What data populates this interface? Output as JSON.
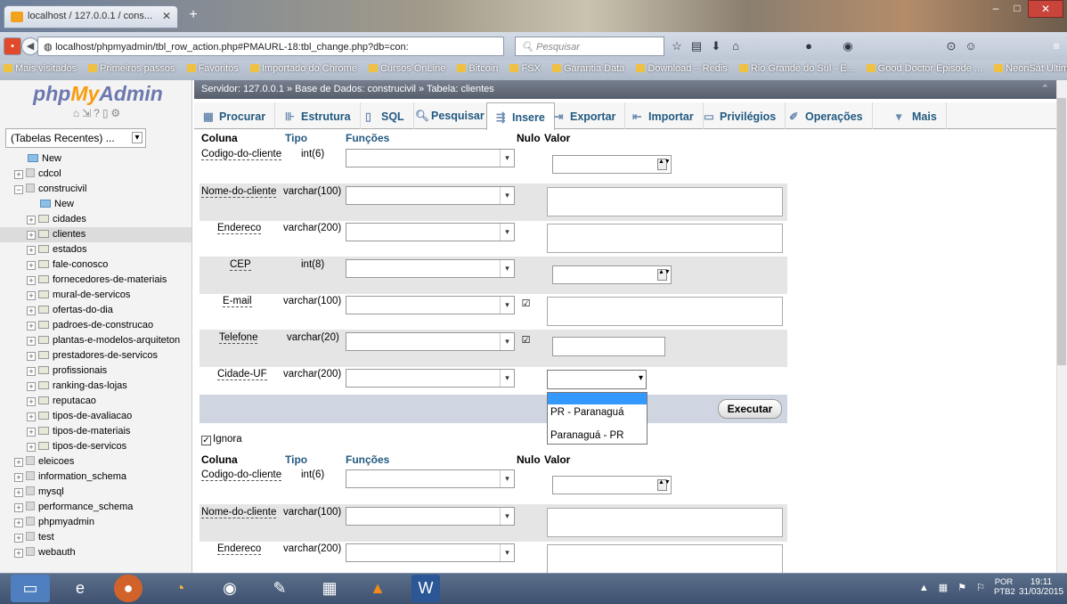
{
  "browser": {
    "tab_title": "localhost / 127.0.0.1 / cons...",
    "url": "localhost/phpmyadmin/tbl_row_action.php#PMAURL-18:tbl_change.php?db=con:",
    "search_placeholder": "Pesquisar",
    "bookmarks": [
      "Mais visitados",
      "Primeiros passos",
      "Favoritos",
      "Importado do Chrome",
      "Cursos OnLine",
      "Bitcoin",
      "FSX",
      "Garantia Data",
      "Download – Redis",
      "Rio Grande do Sul - E...",
      "Good Doctor Episode ...",
      "NeonSat Ultimate | Te..."
    ]
  },
  "sidebar": {
    "logo_php": "php",
    "logo_my": "MyAdmin",
    "logo_admin": "Admin",
    "recent_label": "(Tabelas Recentes) ...",
    "items": [
      {
        "label": "New",
        "kind": "new",
        "level": 0
      },
      {
        "label": "cdcol",
        "kind": "db",
        "level": 0
      },
      {
        "label": "construcivil",
        "kind": "db",
        "level": 0
      },
      {
        "label": "New",
        "kind": "new",
        "level": 1
      },
      {
        "label": "cidades",
        "kind": "table",
        "level": 1
      },
      {
        "label": "clientes",
        "kind": "table",
        "level": 1,
        "selected": true
      },
      {
        "label": "estados",
        "kind": "table",
        "level": 1
      },
      {
        "label": "fale-conosco",
        "kind": "table",
        "level": 1
      },
      {
        "label": "fornecedores-de-materiais",
        "kind": "table",
        "level": 1
      },
      {
        "label": "mural-de-servicos",
        "kind": "table",
        "level": 1
      },
      {
        "label": "ofertas-do-dia",
        "kind": "table",
        "level": 1
      },
      {
        "label": "padroes-de-construcao",
        "kind": "table",
        "level": 1
      },
      {
        "label": "plantas-e-modelos-arquiteton",
        "kind": "table",
        "level": 1
      },
      {
        "label": "prestadores-de-servicos",
        "kind": "table",
        "level": 1
      },
      {
        "label": "profissionais",
        "kind": "table",
        "level": 1
      },
      {
        "label": "ranking-das-lojas",
        "kind": "table",
        "level": 1
      },
      {
        "label": "reputacao",
        "kind": "table",
        "level": 1
      },
      {
        "label": "tipos-de-avaliacao",
        "kind": "table",
        "level": 1
      },
      {
        "label": "tipos-de-materiais",
        "kind": "table",
        "level": 1
      },
      {
        "label": "tipos-de-servicos",
        "kind": "table",
        "level": 1
      },
      {
        "label": "eleicoes",
        "kind": "db",
        "level": 0
      },
      {
        "label": "information_schema",
        "kind": "db",
        "level": 0
      },
      {
        "label": "mysql",
        "kind": "db",
        "level": 0
      },
      {
        "label": "performance_schema",
        "kind": "db",
        "level": 0
      },
      {
        "label": "phpmyadmin",
        "kind": "db",
        "level": 0
      },
      {
        "label": "test",
        "kind": "db",
        "level": 0
      },
      {
        "label": "webauth",
        "kind": "db",
        "level": 0
      }
    ]
  },
  "breadcrumb": "Servidor: 127.0.0.1 » Base de Dados: construcivil » Tabela: clientes",
  "tabs": [
    {
      "label": "Procurar",
      "icon": "table-icon"
    },
    {
      "label": "Estrutura",
      "icon": "structure-icon"
    },
    {
      "label": "SQL",
      "icon": "sql-icon"
    },
    {
      "label": "Pesquisar",
      "icon": "search-icon"
    },
    {
      "label": "Insere",
      "icon": "insert-icon",
      "active": true
    },
    {
      "label": "Exportar",
      "icon": "export-icon"
    },
    {
      "label": "Importar",
      "icon": "import-icon"
    },
    {
      "label": "Privilégios",
      "icon": "privileges-icon"
    },
    {
      "label": "Operações",
      "icon": "wrench-icon"
    },
    {
      "label": "Mais",
      "icon": "chevron-down-icon"
    }
  ],
  "form": {
    "headers": {
      "coluna": "Coluna",
      "tipo": "Tipo",
      "funcoes": "Funções",
      "nulo": "Nulo",
      "valor": "Valor"
    },
    "rows1": [
      {
        "column": "Codigo-do-cliente",
        "type": "int(6)",
        "input": "number",
        "nulo": false
      },
      {
        "column": "Nome-do-cliente",
        "type": "varchar(100)",
        "input": "textarea",
        "nulo": false
      },
      {
        "column": "Endereco",
        "type": "varchar(200)",
        "input": "textarea",
        "nulo": false
      },
      {
        "column": "CEP",
        "type": "int(8)",
        "input": "number",
        "nulo": false
      },
      {
        "column": "E-mail",
        "type": "varchar(100)",
        "input": "textarea",
        "nulo": true
      },
      {
        "column": "Telefone",
        "type": "varchar(20)",
        "input": "text",
        "nulo": true
      },
      {
        "column": "Cidade-UF",
        "type": "varchar(200)",
        "input": "select",
        "nulo": false
      }
    ],
    "rows2": [
      {
        "column": "Codigo-do-cliente",
        "type": "int(6)",
        "input": "number"
      },
      {
        "column": "Nome-do-cliente",
        "type": "varchar(100)",
        "input": "textarea"
      },
      {
        "column": "Endereco",
        "type": "varchar(200)",
        "input": "textarea"
      }
    ],
    "execute_label": "Executar",
    "ignore_label": "Ignora",
    "dropdown_options": [
      "",
      "PR - Paranaguá",
      "Paranaguá - PR"
    ]
  },
  "taskbar": {
    "lang": "POR",
    "lang2": "PTB2",
    "time": "19:11",
    "date": "31/03/2015"
  }
}
